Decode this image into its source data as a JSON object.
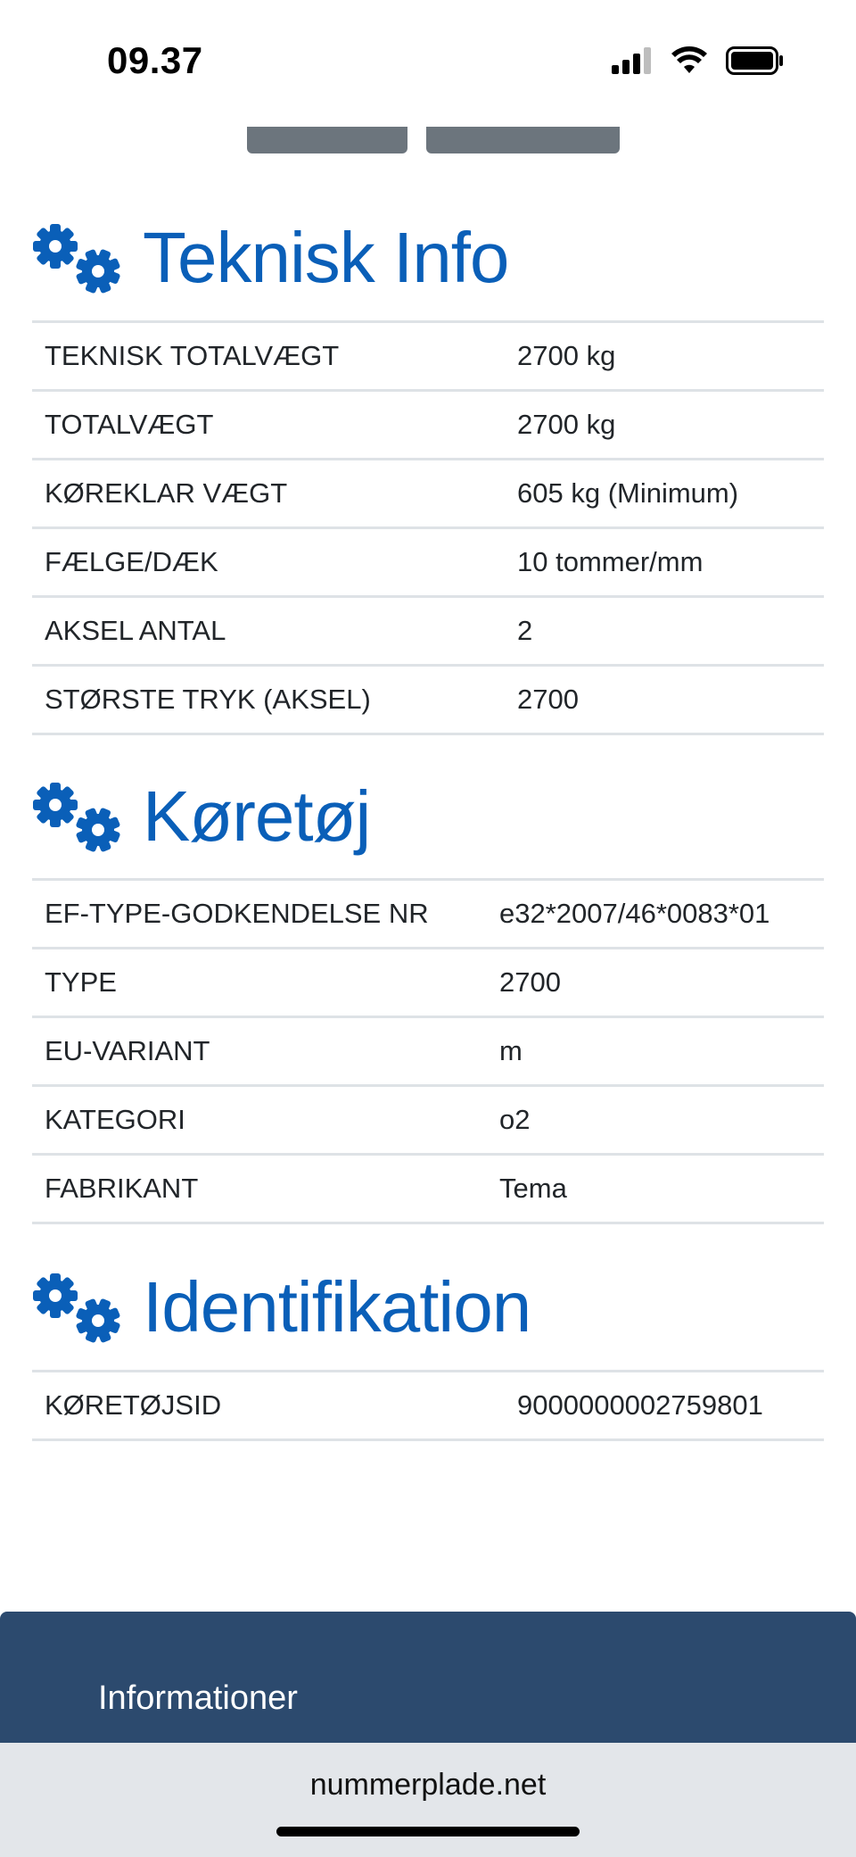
{
  "status_bar": {
    "time": "09.37",
    "icons": [
      "signal-icon",
      "wifi-icon",
      "battery-icon"
    ]
  },
  "sections": [
    {
      "title": "Teknisk Info",
      "icon": "gears-icon",
      "rows": [
        {
          "label": "TEKNISK TOTALVÆGT",
          "value": "2700 kg"
        },
        {
          "label": "TOTALVÆGT",
          "value": "2700 kg"
        },
        {
          "label": "KØREKLAR VÆGT",
          "value": "605 kg (Minimum)"
        },
        {
          "label": "FÆLGE/DÆK",
          "value": "10 tommer/mm"
        },
        {
          "label": "AKSEL ANTAL",
          "value": "2"
        },
        {
          "label": "STØRSTE TRYK (AKSEL)",
          "value": "2700"
        }
      ]
    },
    {
      "title": "Køretøj",
      "icon": "gears-icon",
      "rows": [
        {
          "label": "EF-TYPE-GODKENDELSE NR",
          "value": "e32*2007/46*0083*01"
        },
        {
          "label": "TYPE",
          "value": "2700"
        },
        {
          "label": "EU-VARIANT",
          "value": "m"
        },
        {
          "label": "KATEGORI",
          "value": "o2"
        },
        {
          "label": "FABRIKANT",
          "value": "Tema"
        }
      ]
    },
    {
      "title": "Identifikation",
      "icon": "gears-icon",
      "rows": [
        {
          "label": "KØRETØJSID",
          "value": "9000000002759801"
        }
      ]
    }
  ],
  "footer": {
    "heading": "Informationer"
  },
  "browser": {
    "url": "nummerplade.net"
  },
  "colors": {
    "accent": "#0a5fb8",
    "footer_bg": "#2c4a6e",
    "tab_stub": "#6c757d"
  }
}
